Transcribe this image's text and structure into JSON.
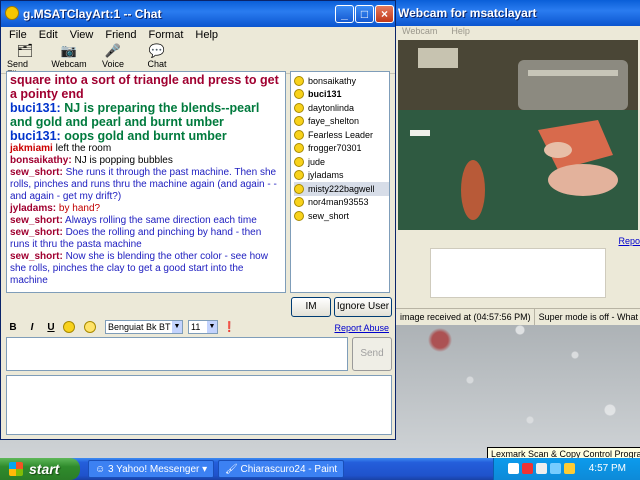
{
  "chat_window": {
    "title": "g.MSATClayArt:1 -- Chat",
    "menu": [
      "File",
      "Edit",
      "View",
      "Friend",
      "Format",
      "Help"
    ],
    "toolbar": [
      {
        "label": "Send File",
        "icon": "send-file-icon"
      },
      {
        "label": "Webcam",
        "icon": "webcam-icon"
      },
      {
        "label": "Voice",
        "icon": "microphone-icon"
      },
      {
        "label": "Chat",
        "icon": "chat-bubbles-icon"
      }
    ],
    "messages": [
      {
        "name": "",
        "text": "square into a sort of triangle and press to get a pointy end",
        "name_color": "#a00030",
        "text_color": "#a00030",
        "large": true
      },
      {
        "name": "buci131:",
        "text": "NJ is preparing the blends--pearl and gold and pearl and burnt umber",
        "name_color": "#0033cc",
        "text_color": "#007a3d",
        "large": true
      },
      {
        "name": "buci131:",
        "text": "oops gold and burnt umber",
        "name_color": "#0033cc",
        "text_color": "#007a3d",
        "large": true
      },
      {
        "name": "jakmiami",
        "text": "left the room",
        "name_color": "#cc0000",
        "text_color": "#000000",
        "large": false
      },
      {
        "name": "bonsaikathy:",
        "text": "NJ is popping bubbles",
        "name_color": "#a00030",
        "text_color": "#000000",
        "large": false
      },
      {
        "name": "sew_short:",
        "text": "She runs it through the past machine. Then she rolls, pinches and runs thru the machine again  (and again - - and again - get my drift?)",
        "name_color": "#a00030",
        "text_color": "#2020c0",
        "large": false
      },
      {
        "name": "jyladams:",
        "text": "by hand?",
        "name_color": "#a00030",
        "text_color": "#c00000",
        "large": false
      },
      {
        "name": "sew_short:",
        "text": "Always rolling the same direction each time",
        "name_color": "#a00030",
        "text_color": "#2020c0",
        "large": false
      },
      {
        "name": "sew_short:",
        "text": "Does the rolling and pinching by hand - then runs it thru the pasta machine",
        "name_color": "#a00030",
        "text_color": "#2020c0",
        "large": false
      },
      {
        "name": "sew_short:",
        "text": "Now she is blending the other color - see how she rolls, pinches the clay to get a good start into the machine",
        "name_color": "#a00030",
        "text_color": "#2020c0",
        "large": false
      }
    ],
    "buddies": [
      {
        "name": "bonsaikathy",
        "bold": false
      },
      {
        "name": "buci131",
        "bold": true
      },
      {
        "name": "daytonlinda",
        "bold": false
      },
      {
        "name": "faye_shelton",
        "bold": false
      },
      {
        "name": "Fearless Leader",
        "bold": false
      },
      {
        "name": "frogger70301",
        "bold": false
      },
      {
        "name": "jude",
        "bold": false
      },
      {
        "name": "jyladams",
        "bold": false
      },
      {
        "name": "misty222bagwell",
        "bold": false
      },
      {
        "name": "nor4man93553",
        "bold": false
      },
      {
        "name": "sew_short",
        "bold": false
      }
    ],
    "selected_buddy": "misty222bagwell",
    "im_button": "IM",
    "ignore_button": "Ignore User",
    "format": {
      "bold": "B",
      "italic": "I",
      "underline": "U",
      "font": "Benguiat Bk BT",
      "size": "11"
    },
    "report_abuse": "Report Abuse",
    "send_button": "Send"
  },
  "webcam_window": {
    "title": "Webcam for msatclayart",
    "menu": [
      "Webcam",
      "Help"
    ],
    "report_link": "Repo",
    "status_received": "image received at (04:57:56 PM)",
    "status_super": "Super mode is off - What"
  },
  "tooltip": "Lexmark Scan & Copy Control Program",
  "taskbar": {
    "start_label": "start",
    "tasks": [
      "3 Yahoo! Messenger",
      "Chiarascuro24 - Paint"
    ],
    "clock": "4:57 PM"
  },
  "colors": {
    "taskbar_blue": "#245edb",
    "start_green": "#2f8b2c",
    "title_blue": "#0a5fd8"
  }
}
